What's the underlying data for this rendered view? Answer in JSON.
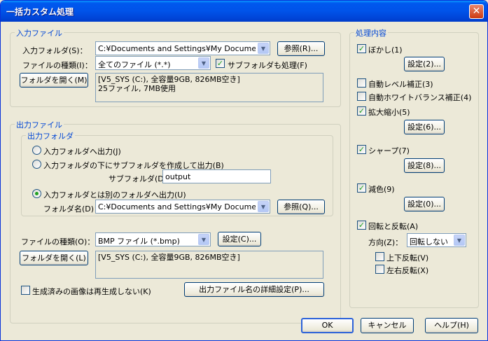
{
  "window": {
    "title": "一括カスタム処理",
    "close_glyph": "✕"
  },
  "input_file": {
    "group_title": "入力ファイル",
    "folder_label": "入力フォルダ(S)：",
    "folder_value": "C:¥Documents and Settings¥My Documents",
    "browse_label": "参照(R)...",
    "type_label": "ファイルの種類(I)：",
    "type_value": "全てのファイル (*.*)",
    "subfolder_label": "サブフォルダも処理(F)",
    "subfolder_checked": true,
    "open_folder_label": "フォルダを開く(M)",
    "info_line1": "[V5_SYS (C:), 全容量9GB, 826MB空き]",
    "info_line2": "25ファイル, 7MB使用"
  },
  "output_file": {
    "group_title": "出力ファイル",
    "folder_group_title": "出力フォルダ",
    "radio1_label": "入力フォルダへ出力(J)",
    "radio2_label": "入力フォルダの下にサブフォルダを作成して出力(B)",
    "subfolder_label": "サブフォルダ(D)：",
    "subfolder_value": "output",
    "radio3_label": "入力フォルダとは別のフォルダへ出力(U)",
    "folder_name_label": "フォルダ名(D)：",
    "folder_name_value": "C:¥Documents and Settings¥My Documents",
    "browse_label": "参照(Q)...",
    "type_label": "ファイルの種類(O)：",
    "type_value": "BMP ファイル (*.bmp)",
    "settings_label": "設定(C)...",
    "open_folder_label": "フォルダを開く(L)",
    "info_line1": "[V5_SYS (C:), 全容量9GB, 826MB空き]",
    "skip_label": "生成済みの画像は再生成しない(K)",
    "detail_label": "出力ファイル名の詳細設定(P)..."
  },
  "processing": {
    "group_title": "処理内容",
    "blur_label": "ぼかし(1)",
    "blur_settings": "設定(2)...",
    "auto_level_label": "自動レベル補正(3)",
    "auto_white_label": "自動ホワイトバランス補正(4)",
    "resize_label": "拡大縮小(5)",
    "resize_settings": "設定(6)...",
    "sharpen_label": "シャープ(7)",
    "sharpen_settings": "設定(8)...",
    "reduce_label": "減色(9)",
    "reduce_settings": "設定(0)...",
    "rotate_label": "回転と反転(A)",
    "direction_label": "方向(Z)：",
    "direction_value": "回転しない",
    "flip_v_label": "上下反転(V)",
    "flip_h_label": "左右反転(X)"
  },
  "footer": {
    "ok_label": "OK",
    "cancel_label": "キャンセル",
    "help_label": "ヘルプ(H)"
  }
}
